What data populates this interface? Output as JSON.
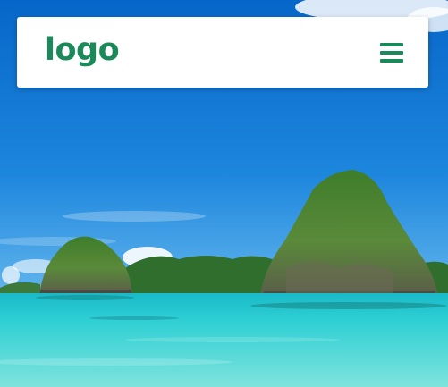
{
  "brand": {
    "logo_text": "logo",
    "accent_color": "#1b8a5a"
  },
  "navbar": {
    "menu_icon": "hamburger-menu-icon"
  },
  "hero": {
    "background_image": "tropical-sea-rock-islands-photo"
  }
}
